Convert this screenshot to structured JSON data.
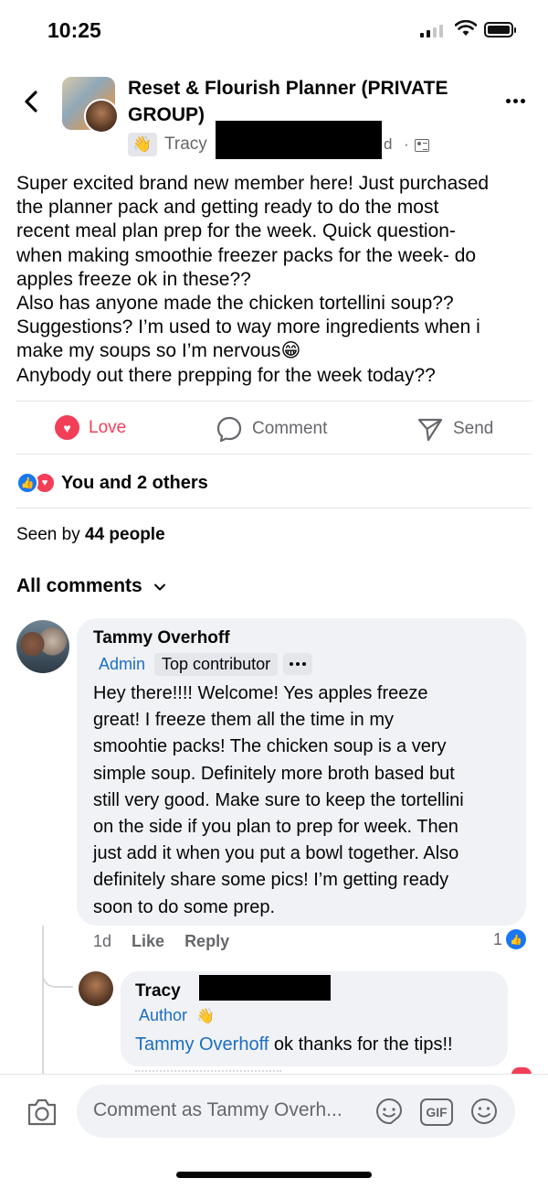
{
  "status_bar": {
    "time": "10:25"
  },
  "header": {
    "group_name": "Reset & Flourish Planner (PRIVATE GROUP)",
    "author_name": "Tracy",
    "time_suffix": "d",
    "dot": "·"
  },
  "post": {
    "lines": [
      "Super excited brand new member here!  Just purchased",
      "the planner pack and getting ready to do the most",
      "recent meal plan prep for the week. Quick question-",
      "when making smoothie freezer packs for the week- do",
      "apples freeze ok in these??",
      "Also has anyone made the chicken tortellini soup??",
      "Suggestions?  I’m used to way more ingredients when i",
      "make my soups so I’m nervous",
      "Anybody out there prepping for the week today??"
    ],
    "emoji": "😁"
  },
  "actions": {
    "love": "Love",
    "comment": "Comment",
    "send": "Send"
  },
  "reactions": {
    "text": "You and 2 others"
  },
  "seen": {
    "prefix": "Seen by ",
    "count": "44 people"
  },
  "comments_filter": {
    "label": "All comments"
  },
  "comment": {
    "author": "Tammy Overhoff",
    "badge_admin": "Admin",
    "badge_top": "Top contributor",
    "lines": [
      "Hey there!!!! Welcome! Yes apples freeze",
      "great! I freeze them all the time in my",
      "smoohtie packs! The chicken soup is a very",
      "simple soup. Definitely more broth based but",
      "still very good. Make sure to keep the tortellini",
      "on the side if you plan to prep for week. Then",
      "just add it when you put a bowl together. Also",
      "definitely share some pics! I’m getting ready",
      "soon to do some prep."
    ],
    "time": "1d",
    "like_label": "Like",
    "reply_label": "Reply",
    "like_count": "1"
  },
  "reply": {
    "author": "Tracy",
    "badge": "Author",
    "mention": "Tammy Overhoff",
    "text": " ok thanks for the tips!!"
  },
  "composer": {
    "placeholder": "Comment as Tammy Overh...",
    "gif_label": "GIF"
  },
  "colors": {
    "accent_blue": "#1877f2",
    "link_blue": "#1b6ec2",
    "love_red": "#f33e58",
    "muted": "#65676b",
    "bubble_bg": "#f0f2f5"
  }
}
